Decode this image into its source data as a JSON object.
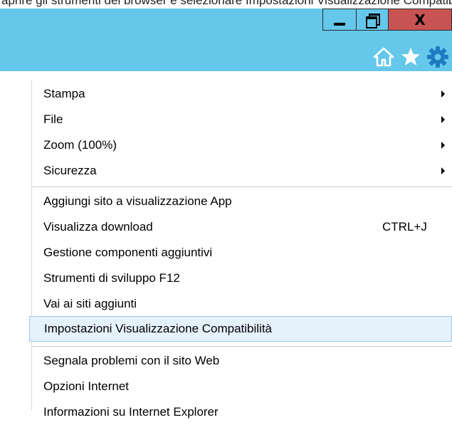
{
  "top_strip": {
    "text": "aprire gli strumenti del browser e selezionare Impostazioni Visualizzazione Compatibilità"
  },
  "window_controls": {
    "minimize": "minimize",
    "maximize": "maximize",
    "close": "X"
  },
  "toolbar": {
    "icons": [
      "home-icon",
      "favorites-star-icon",
      "tools-gear-icon"
    ]
  },
  "colors": {
    "titlebar": "#65c8ea",
    "close": "#c85353",
    "icons": "#ffffff",
    "highlight": "#e5f1fb"
  },
  "menu": {
    "groups": [
      {
        "items": [
          {
            "label": "Stampa",
            "submenu": true
          },
          {
            "label": "File",
            "submenu": true
          },
          {
            "label": "Zoom (100%)",
            "submenu": true
          },
          {
            "label": "Sicurezza",
            "submenu": true
          }
        ]
      },
      {
        "items": [
          {
            "label": "Aggiungi sito a visualizzazione App"
          },
          {
            "label": "Visualizza download",
            "shortcut": "CTRL+J"
          },
          {
            "label": "Gestione componenti aggiuntivi"
          },
          {
            "label": "Strumenti di sviluppo F12"
          },
          {
            "label": "Vai ai siti aggiunti"
          },
          {
            "label": "Impostazioni Visualizzazione Compatibilità",
            "highlighted": true
          }
        ]
      },
      {
        "items": [
          {
            "label": "Segnala problemi con il sito Web"
          },
          {
            "label": "Opzioni Internet"
          },
          {
            "label": "Informazioni su Internet Explorer"
          }
        ]
      }
    ]
  }
}
